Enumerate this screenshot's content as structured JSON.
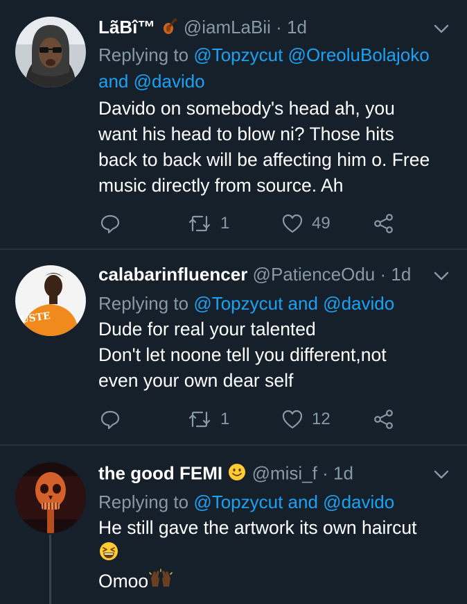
{
  "tweets": [
    {
      "name": "LãBî™",
      "name_emoji": "violin-emoji",
      "handle": "@iamLaBii",
      "dot": "·",
      "time": "1d",
      "replying_prefix": "Replying to ",
      "mention_1": "@Topzycut",
      "mention_2": "@OreoluBolajoko",
      "joiner": "and",
      "mention_3": "@davido",
      "text_lines": [
        "Davido on somebody's head ah, you",
        "want his head to blow ni? Those hits",
        "back to back will be affecting him o. Free",
        "music directly from source. Ah"
      ],
      "retweets": "1",
      "likes": "49"
    },
    {
      "name": "calabarinfluencer",
      "handle": "@PatienceOdu",
      "dot": "·",
      "time": "1d",
      "replying_prefix": "Replying to ",
      "mention_1": "@Topzycut",
      "joiner": "and",
      "mention_2": "@davido",
      "avatar_text": "USTE",
      "text_lines": [
        "Dude for real your talented",
        "Don't let noone tell you different,not",
        "even your own dear self"
      ],
      "retweets": "1",
      "likes": "12"
    },
    {
      "name": "the good FEMI",
      "name_emoji": "smiling-face-emoji",
      "handle": "@misi_f",
      "dot": "·",
      "time": "1d",
      "replying_prefix": "Replying to ",
      "mention_1": "@Topzycut",
      "joiner": "and",
      "mention_2": "@davido",
      "text_line_1": "He still gave the artwork its own haircut",
      "text_line_2_emoji": "grinning-squinting-face-emoji",
      "text_line_3": "Omoo",
      "text_line_3_emoji": "raising-hands-emoji"
    }
  ],
  "colors": {
    "background": "#15202b",
    "text_primary": "#ffffff",
    "text_secondary": "#8899a6",
    "link": "#1da1f2",
    "divider": "#253341"
  }
}
